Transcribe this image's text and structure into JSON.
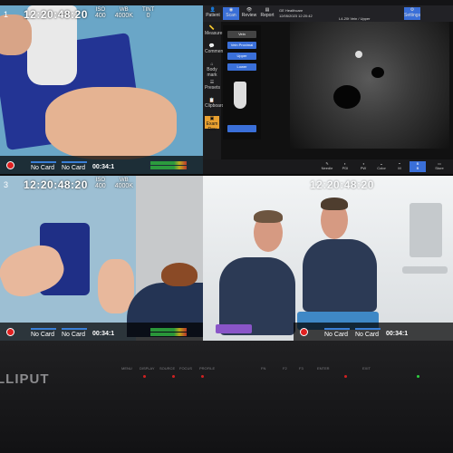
{
  "monitor": {
    "brand": "LLIPUT"
  },
  "q1": {
    "cam_label": "1",
    "time": "12:20:48:20",
    "fields": [
      {
        "label": "ISO",
        "value": "400"
      },
      {
        "label": "WB",
        "value": "4000K"
      },
      {
        "label": "TINT",
        "value": "0"
      }
    ],
    "card_a": "No Card",
    "card_b": "No Card",
    "timecode": "00:34:1"
  },
  "q3": {
    "cam_label": "3",
    "time": "12:20:48:20",
    "fields": [
      {
        "label": "ISO",
        "value": "400"
      },
      {
        "label": "WB",
        "value": "4000K"
      }
    ],
    "card_a": "No Card",
    "card_b": "No Card",
    "timecode": "00:34:1"
  },
  "q4": {
    "time": "12:20:48:20",
    "card_a": "No Card",
    "card_b": "No Card",
    "timecode": "00:34:1"
  },
  "ultrasound": {
    "top_buttons": [
      "Patient",
      "Scan",
      "Review",
      "Report",
      "Settings"
    ],
    "vendor": "GE Healthcare",
    "date": "12/05/2023 12:20:42",
    "exam": "L4-20t  Vein / Upper",
    "side_items": [
      "Measure",
      "Comment",
      "Body mark",
      "Presets",
      "Clipboard",
      "Exam Rev"
    ],
    "menu": [
      "Vein",
      "Vein Proximal",
      "Upper",
      "Lower"
    ],
    "bottom_buttons": [
      "Needle",
      "PDI",
      "PW",
      "Color",
      "M",
      "B",
      "Store"
    ]
  },
  "controls": [
    "MENU",
    "DISPLAY",
    "SOURCE",
    "FOCUS",
    "PROFILE",
    "FN",
    "F2",
    "F3",
    "ENTER",
    "EXIT"
  ],
  "colors": {
    "rec": "#e02020",
    "accent": "#3a6fd8",
    "pad": "#1f2f86"
  }
}
